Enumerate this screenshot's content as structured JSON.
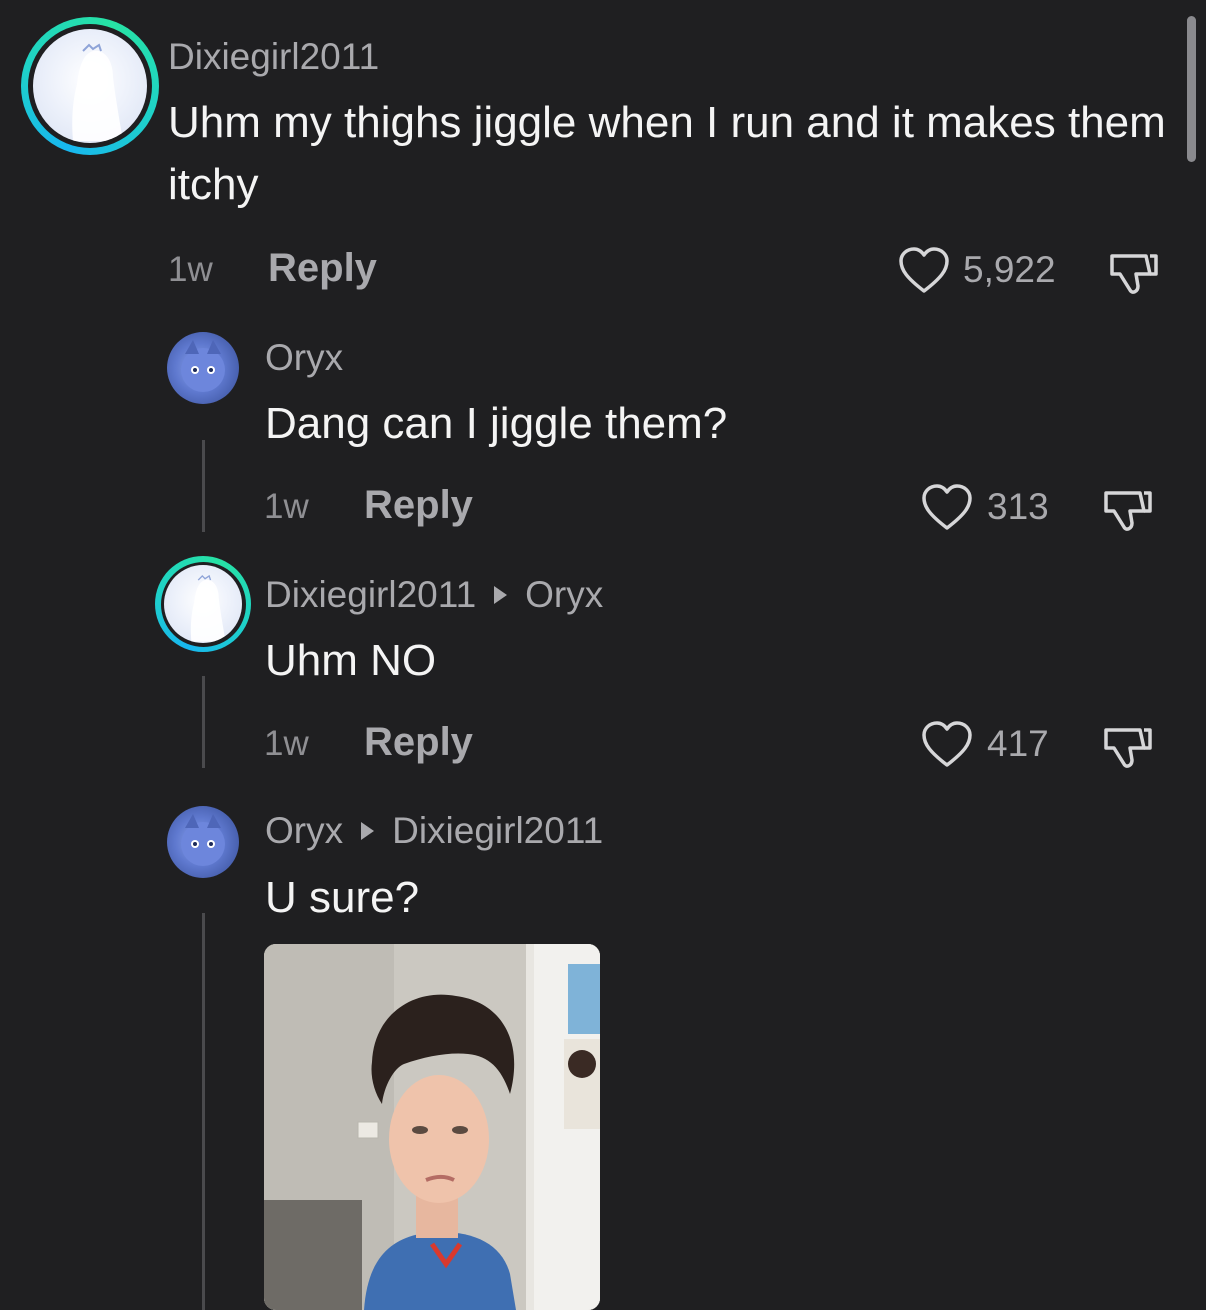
{
  "comments": [
    {
      "username": "Dixiegirl2011",
      "text": "Uhm my thighs jiggle when I run and it makes them itchy",
      "time": "1w",
      "reply_label": "Reply",
      "likes": "5,922"
    },
    {
      "username": "Oryx",
      "text": "Dang can I jiggle them?",
      "time": "1w",
      "reply_label": "Reply",
      "likes": "313"
    },
    {
      "username": "Dixiegirl2011",
      "reply_to": "Oryx",
      "text": "Uhm NO",
      "time": "1w",
      "reply_label": "Reply",
      "likes": "417"
    },
    {
      "username": "Oryx",
      "reply_to": "Dixiegirl2011",
      "text": "U sure?"
    }
  ],
  "colors": {
    "background": "#1f1f21",
    "ring_gradient": [
      "#18b7f0",
      "#27e2a4"
    ],
    "muted_text": "#a9a9ad"
  },
  "icons": [
    "heart-icon",
    "dislike-icon",
    "reply-arrow-icon"
  ]
}
